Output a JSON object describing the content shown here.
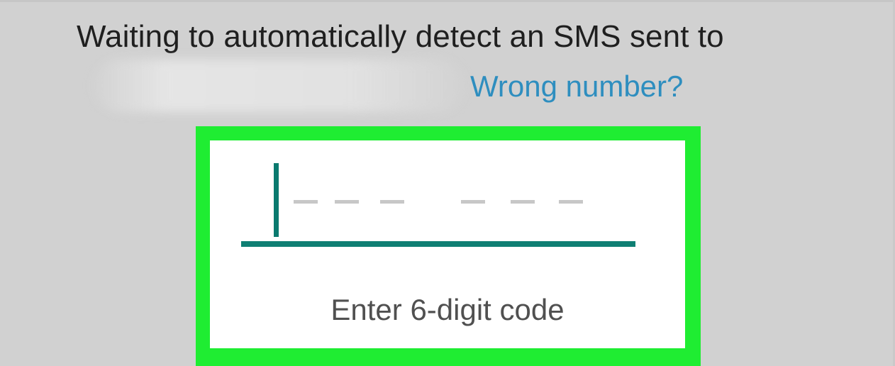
{
  "screen": {
    "message": "Waiting to automatically detect an SMS sent to",
    "wrong_number_link": "Wrong number?",
    "code_label": "Enter 6-digit code",
    "code_value": ""
  },
  "colors": {
    "background": "#d1d1d1",
    "highlight": "#1fed32",
    "accent": "#0f7f73",
    "link": "#2e8ebf"
  },
  "icons": {
    "cursor": "text-cursor",
    "placeholder_group_1": "dash-placeholder",
    "placeholder_group_2": "dash-placeholder"
  }
}
